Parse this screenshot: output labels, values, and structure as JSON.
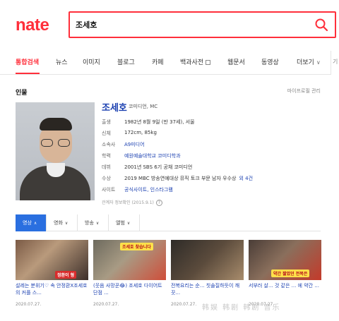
{
  "header": {
    "logo": "nate",
    "search_value": "조세호"
  },
  "nav": {
    "items": [
      "통합검색",
      "뉴스",
      "이미지",
      "블로그",
      "카페",
      "백과사전",
      "웹문서",
      "동영상",
      "더보기"
    ],
    "fade_char": "기"
  },
  "section": {
    "title": "인물",
    "edit_link": "마이프로필 관리"
  },
  "profile": {
    "name": "조세호",
    "subtitle": "코미디언, MC",
    "rows": [
      {
        "label": "출생",
        "value": "1982년 8월 9일 (만 37세), 서울"
      },
      {
        "label": "신체",
        "value": "172cm, 85kg"
      },
      {
        "label": "소속사",
        "value": "A9미디어"
      },
      {
        "label": "학력",
        "value": "예원예술대학교 코미디학과"
      },
      {
        "label": "데뷔",
        "value": "2001년 SBS 6기 공채 코미디언"
      },
      {
        "label": "수상",
        "value": "2019 MBC 방송연예대상 뮤직 토크 부문 남자 우수상",
        "extra": "외 4건"
      },
      {
        "label": "사이트",
        "value": "공식사이트, 인스타그램"
      }
    ],
    "verify": "관계자 정보확인 (2015.9.1)",
    "help": "?"
  },
  "tabs": [
    "영상",
    "영화",
    "방송",
    "앨범"
  ],
  "videos": [
    {
      "title": "설레는 분위기♡ 속 안정환X조세호의 커플 스...",
      "date": "2020.07.27.",
      "tag": "정환이 형"
    },
    {
      "title": "(웃음 사망꾼😂) 조세호 다이어트 단점 ...",
      "date": "2020.07.27.",
      "tag": "조세호 찾습니다"
    },
    {
      "title": "전복요리는 순... 칫솔질하듯이 깨끗...",
      "date": "2020.07.27.",
      "tag": ""
    },
    {
      "title": "서부러 살... 것 같은 ... 에 약간 ...",
      "date": "2020.07.27.",
      "tag": "약간 짧았던 전복은"
    }
  ],
  "watermark": "韩娱 韩剧 韩剧 音乐",
  "colors": {
    "brand": "#ff2f3b",
    "link": "#1a3fb0",
    "tab_active": "#2a6fe0"
  },
  "icons": {
    "search": "search-icon",
    "help": "help-circle-icon",
    "chevron": "chevron-down-icon"
  }
}
